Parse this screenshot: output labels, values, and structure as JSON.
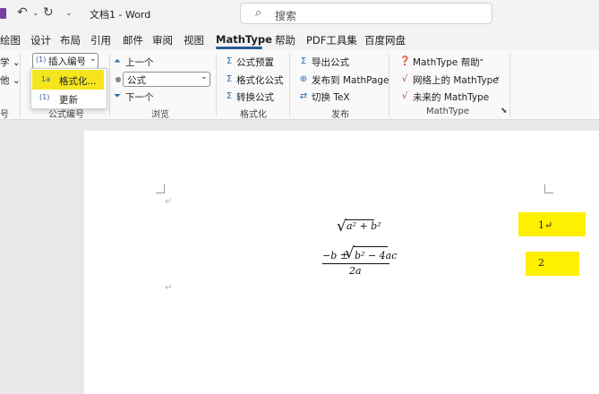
{
  "window": {
    "title": "文档1 - Word",
    "search_placeholder": "搜索"
  },
  "tabs": [
    {
      "label": "绘图"
    },
    {
      "label": "设计"
    },
    {
      "label": "布局"
    },
    {
      "label": "引用"
    },
    {
      "label": "邮件"
    },
    {
      "label": "审阅"
    },
    {
      "label": "视图"
    },
    {
      "label": "MathType",
      "active": true
    },
    {
      "label": "帮助"
    },
    {
      "label": "PDF工具集"
    },
    {
      "label": "百度网盘"
    }
  ],
  "ribbon": {
    "left_partial": {
      "row1": "学 ⌄",
      "row2": "他 ⌄",
      "group": "号"
    },
    "numbering": {
      "insert_label": "插入编号",
      "insert_icon_text": "(1)",
      "group_label": "公式编号",
      "dropdown": [
        {
          "label": "格式化...",
          "icon_text": "1a",
          "highlighted": true
        },
        {
          "label": "更新",
          "icon_text": "(1)"
        }
      ]
    },
    "browse": {
      "prev": "上一个",
      "select_value": "公式",
      "next": "下一个",
      "group_label": "浏览"
    },
    "format": {
      "items": [
        "公式预置",
        "格式化公式",
        "转换公式"
      ],
      "group_label": "格式化"
    },
    "publish": {
      "items": [
        "导出公式",
        "发布到 MathPage",
        "切换 TeX"
      ],
      "group_label": "发布"
    },
    "mathtype": {
      "items": [
        "MathType 帮助",
        "网络上的 MathType",
        "未来的 MathType"
      ],
      "group_label": "MathType"
    }
  },
  "document": {
    "paragraph_mark": "↵",
    "equations": {
      "eq1_radicand": "a² + b²",
      "eq2_numerator_left": "−b ±",
      "eq2_radicand": "b² − 4ac",
      "eq2_denominator": "2a"
    },
    "equation_numbers": [
      "1↵",
      "2"
    ]
  },
  "colors": {
    "highlight": "#ffef00",
    "dropdown_highlight": "#f5e51e",
    "accent": "#2b5797"
  }
}
